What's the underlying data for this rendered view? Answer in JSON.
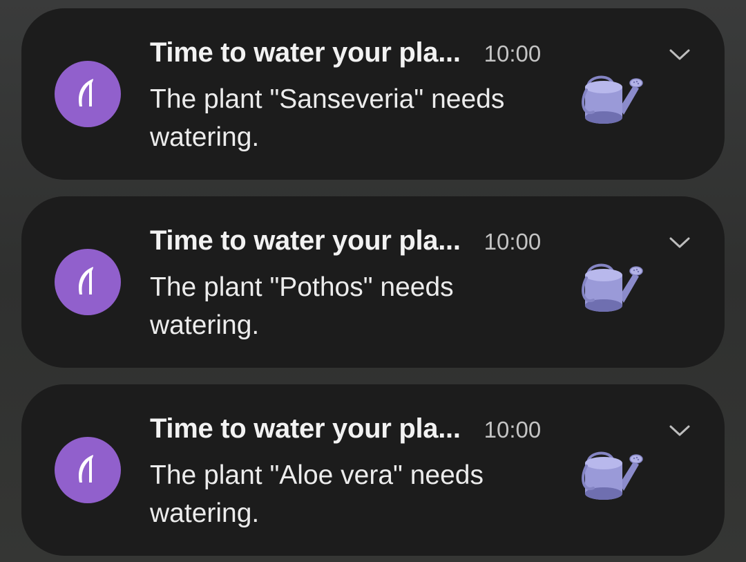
{
  "notifications": [
    {
      "title": "Time to water your pla...",
      "time": "10:00",
      "body": "The plant \"Sanseveria\" needs watering."
    },
    {
      "title": "Time to water your pla...",
      "time": "10:00",
      "body": "The plant \"Pothos\" needs watering."
    },
    {
      "title": "Time to water your pla...",
      "time": "10:00",
      "body": "The plant \"Aloe vera\" needs watering."
    }
  ],
  "icons": {
    "app": "plant-leaf-icon",
    "thumbnail": "watering-can-icon",
    "expand": "chevron-down-icon"
  },
  "colors": {
    "app_icon_bg": "#9160cc",
    "card_bg": "#1c1c1c",
    "watering_can": "#9a9ad8"
  }
}
